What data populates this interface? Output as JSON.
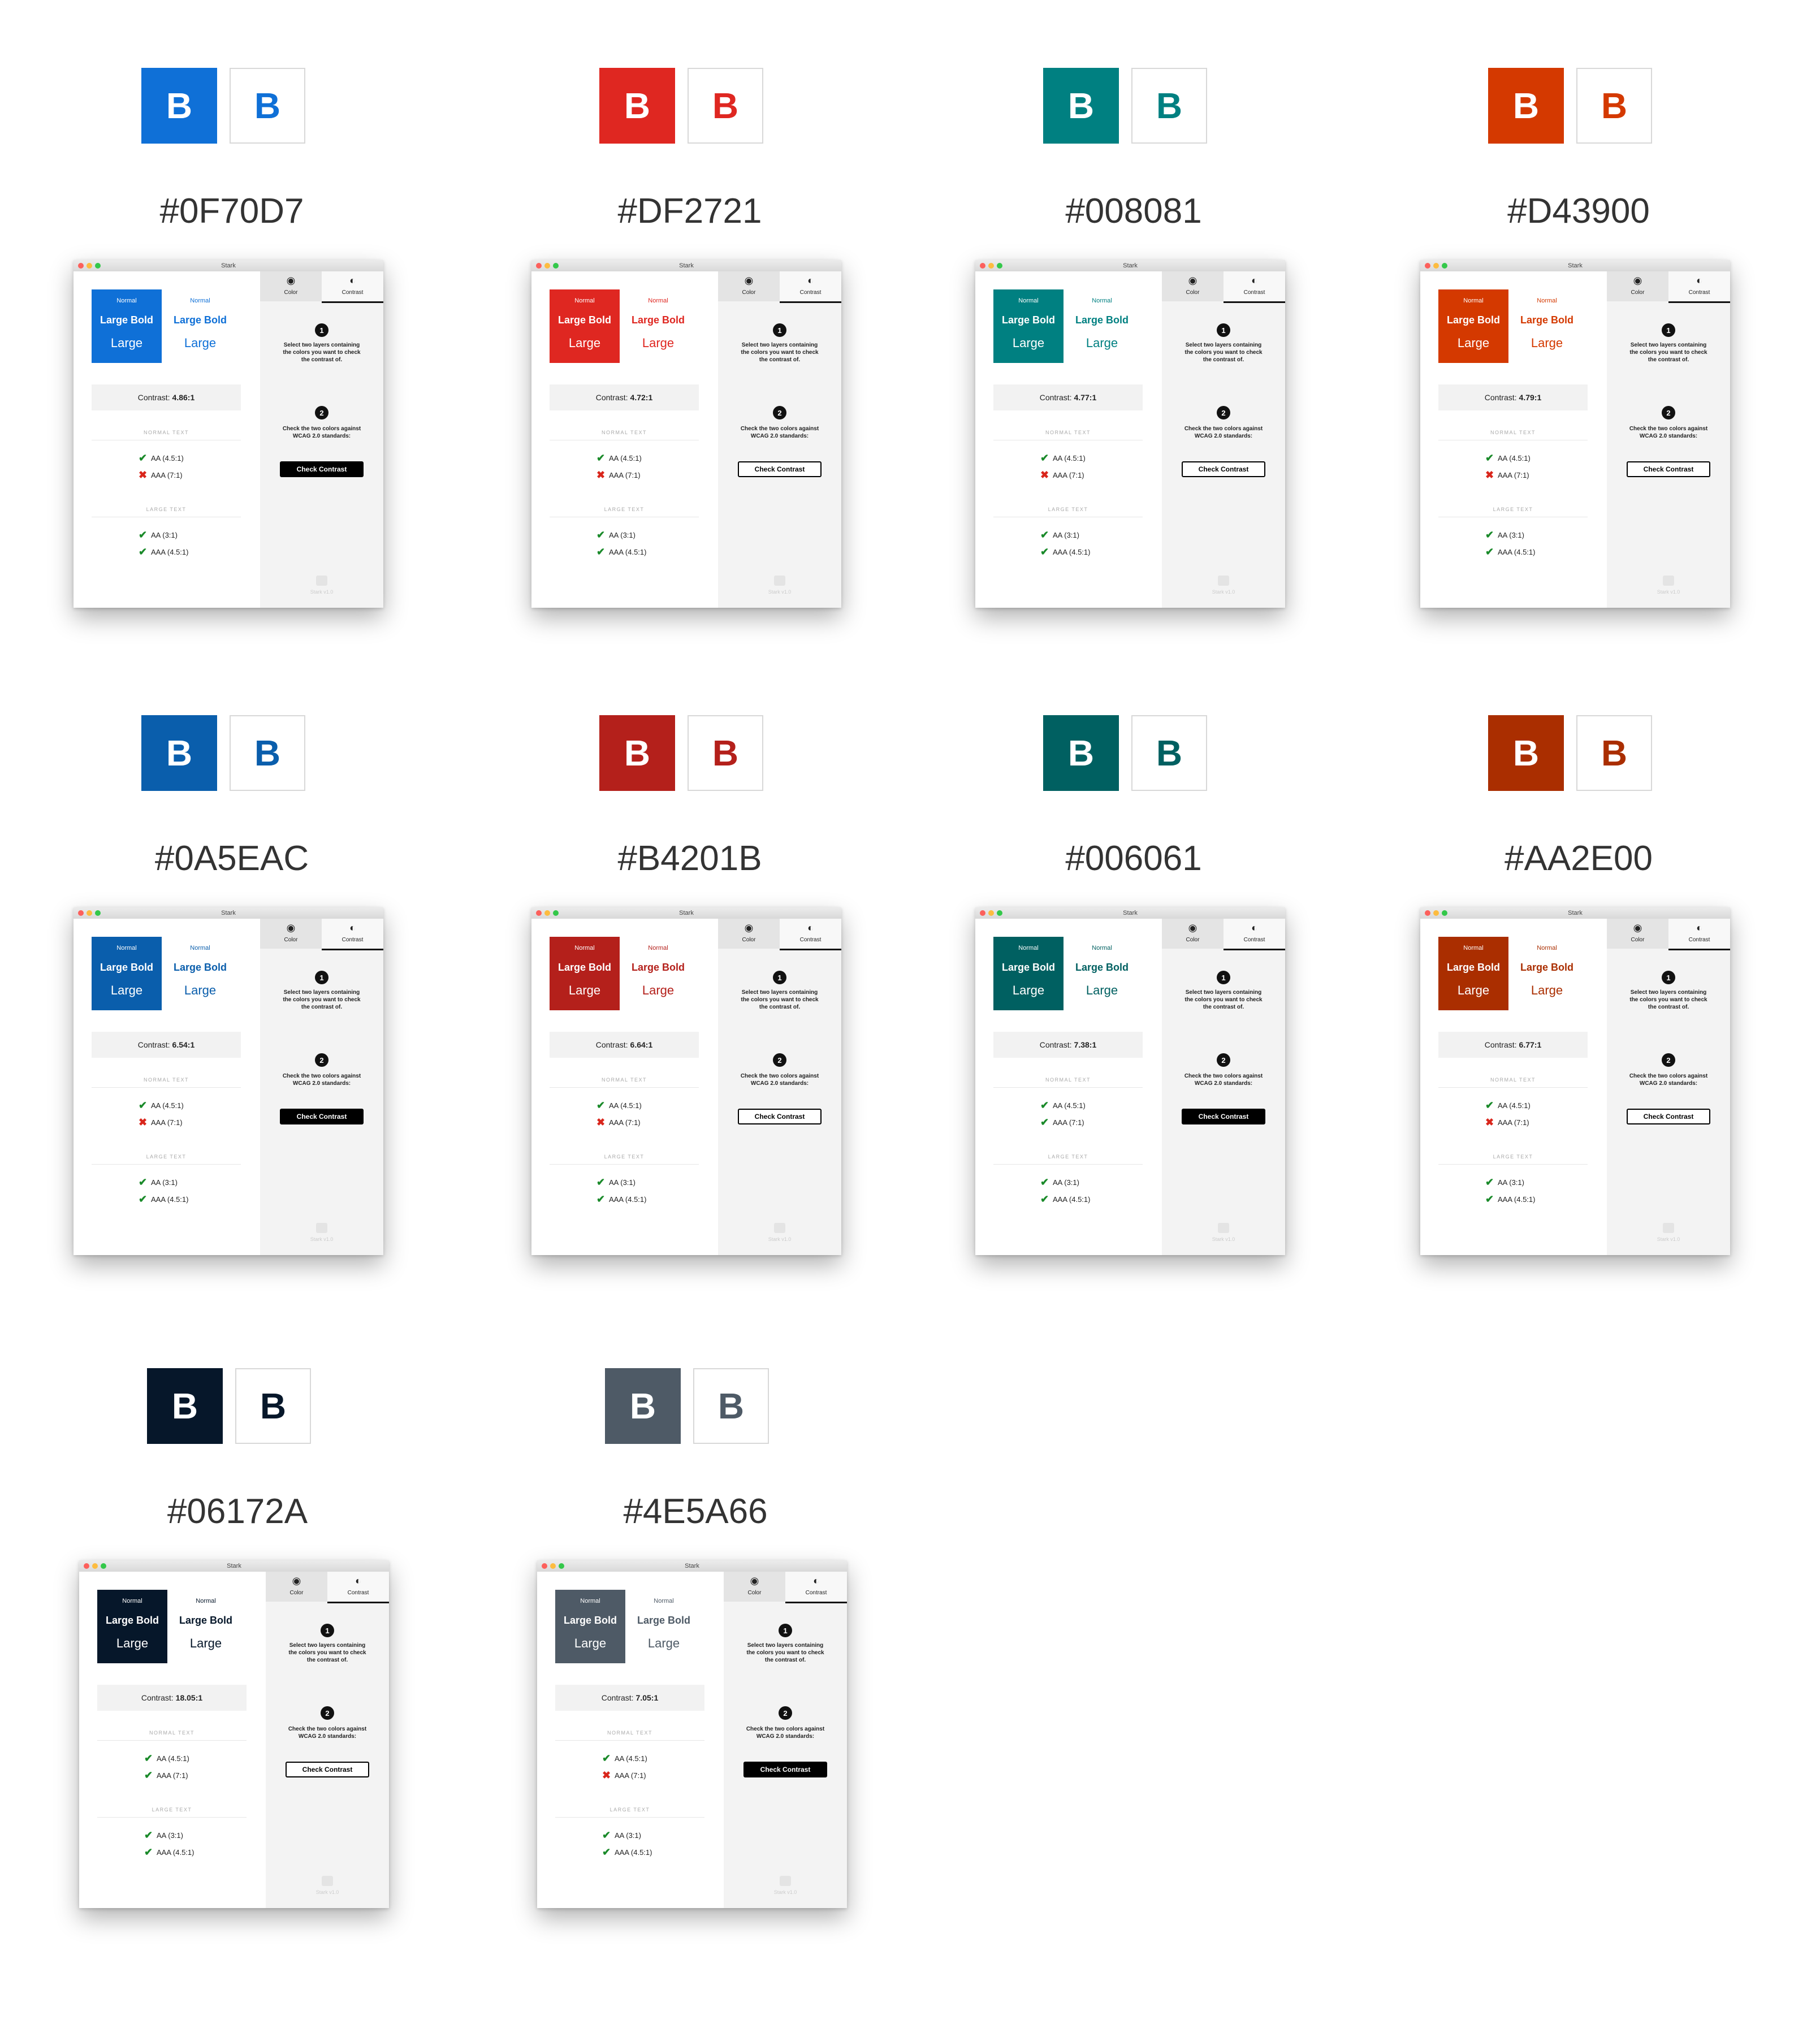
{
  "app": {
    "window_title": "Stark",
    "preview_normal": "Normal",
    "preview_large_bold": "Large Bold",
    "preview_large": "Large",
    "contrast_prefix": "Contrast:",
    "normal_text_heading": "NORMAL TEXT",
    "large_text_heading": "LARGE TEXT",
    "aa_normal": "AA (4.5:1)",
    "aaa_normal": "AAA (7:1)",
    "aa_large": "AA (3:1)",
    "aaa_large": "AAA (4.5:1)",
    "tab_color": "Color",
    "tab_contrast": "Contrast",
    "step1_num": "1",
    "step1_text": "Select two layers containing the colors you want to check the contrast of.",
    "step2_num": "2",
    "step2_text": "Check the two colors against WCAG 2.0 standards:",
    "check_button": "Check Contrast",
    "version": "Stark v1.0",
    "swatch_letter": "B",
    "icon_eye": "eye-icon",
    "icon_contrast": "contrast-icon",
    "pass_glyph": "✔",
    "fail_glyph": "✖"
  },
  "cells": [
    {
      "hex": "#0F70D7",
      "color": "#0F70D7",
      "ratio": "4.86:1",
      "aa_normal": true,
      "aaa_normal": false,
      "aa_large": true,
      "aaa_large": true,
      "button_style": "dark"
    },
    {
      "hex": "#DF2721",
      "color": "#DF2721",
      "ratio": "4.72:1",
      "aa_normal": true,
      "aaa_normal": false,
      "aa_large": true,
      "aaa_large": true,
      "button_style": "light"
    },
    {
      "hex": "#008081",
      "color": "#008081",
      "ratio": "4.77:1",
      "aa_normal": true,
      "aaa_normal": false,
      "aa_large": true,
      "aaa_large": true,
      "button_style": "light"
    },
    {
      "hex": "#D43900",
      "color": "#D43900",
      "ratio": "4.79:1",
      "aa_normal": true,
      "aaa_normal": false,
      "aa_large": true,
      "aaa_large": true,
      "button_style": "light"
    },
    {
      "hex": "#0A5EAC",
      "color": "#0A5EAC",
      "ratio": "6.54:1",
      "aa_normal": true,
      "aaa_normal": false,
      "aa_large": true,
      "aaa_large": true,
      "button_style": "dark"
    },
    {
      "hex": "#B4201B",
      "color": "#B4201B",
      "ratio": "6.64:1",
      "aa_normal": true,
      "aaa_normal": false,
      "aa_large": true,
      "aaa_large": true,
      "button_style": "light"
    },
    {
      "hex": "#006061",
      "color": "#006061",
      "ratio": "7.38:1",
      "aa_normal": true,
      "aaa_normal": true,
      "aa_large": true,
      "aaa_large": true,
      "button_style": "dark"
    },
    {
      "hex": "#AA2E00",
      "color": "#AA2E00",
      "ratio": "6.77:1",
      "aa_normal": true,
      "aaa_normal": false,
      "aa_large": true,
      "aaa_large": true,
      "button_style": "light"
    },
    {
      "hex": "#06172A",
      "color": "#06172A",
      "ratio": "18.05:1",
      "aa_normal": true,
      "aaa_normal": true,
      "aa_large": true,
      "aaa_large": true,
      "button_style": "light"
    },
    {
      "hex": "#4E5A66",
      "color": "#4E5A66",
      "ratio": "7.05:1",
      "aa_normal": true,
      "aaa_normal": false,
      "aa_large": true,
      "aaa_large": true,
      "button_style": "dark"
    }
  ]
}
